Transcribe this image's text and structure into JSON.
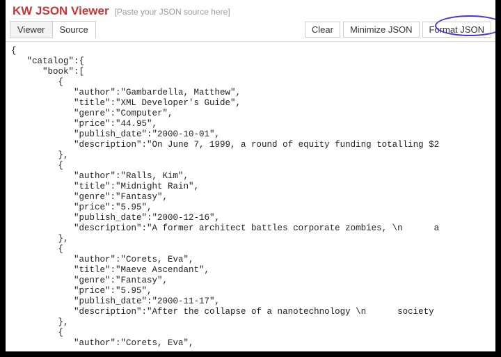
{
  "app": {
    "title": "KW JSON Viewer",
    "hint": "[Paste your JSON source here]"
  },
  "tabs": {
    "viewer": "Viewer",
    "source": "Source",
    "active": "source"
  },
  "actions": {
    "clear": "Clear",
    "minimize": "Minimize JSON",
    "format": "Format JSON"
  },
  "source_text": "{\n   \"catalog\":{\n      \"book\":[\n         {\n            \"author\":\"Gambardella, Matthew\",\n            \"title\":\"XML Developer's Guide\",\n            \"genre\":\"Computer\",\n            \"price\":\"44.95\",\n            \"publish_date\":\"2000-10-01\",\n            \"description\":\"On June 7, 1999, a round of equity funding totalling $2\n         },\n         {\n            \"author\":\"Ralls, Kim\",\n            \"title\":\"Midnight Rain\",\n            \"genre\":\"Fantasy\",\n            \"price\":\"5.95\",\n            \"publish_date\":\"2000-12-16\",\n            \"description\":\"A former architect battles corporate zombies, \\n      a\n         },\n         {\n            \"author\":\"Corets, Eva\",\n            \"title\":\"Maeve Ascendant\",\n            \"genre\":\"Fantasy\",\n            \"price\":\"5.95\",\n            \"publish_date\":\"2000-11-17\",\n            \"description\":\"After the collapse of a nanotechnology \\n      society \n         },\n         {\n            \"author\":\"Corets, Eva\","
}
